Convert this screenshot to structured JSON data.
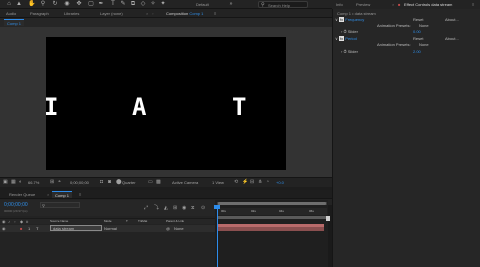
{
  "toolbar": {
    "workspace_default": "Default",
    "search_placeholder": "Search Help"
  },
  "panels": {
    "row": [
      "Audio",
      "Paragraph",
      "Libraries",
      "Layer (none)"
    ],
    "comp_tab_prefix": "Composition",
    "comp_tab_name": "Comp 1",
    "comp_subtab": "Comp 1"
  },
  "viewer": {
    "letters": [
      "I",
      "A",
      "T"
    ],
    "zoom": "66.7%",
    "timecode": "0;00;00;00",
    "resolution": "Quarter",
    "camera": "Active Camera",
    "views": "1 View",
    "exposure": "+0.0"
  },
  "right_panel": {
    "tabs": [
      "Info",
      "Preview",
      "Effect Controls data stream"
    ],
    "breadcrumb": "Comp 1 • data stream",
    "rows": [
      {
        "name": "Frequency",
        "c1": "Reset",
        "c2": "About..."
      },
      {
        "name": "Animation Presets:",
        "c1": "None"
      },
      {
        "name": "Slider",
        "value": "0.00"
      },
      {
        "name": "Period",
        "c1": "Reset",
        "c2": "About..."
      },
      {
        "name": "Animation Presets:",
        "c1": "None"
      },
      {
        "name": "Slider",
        "value": "2.00"
      }
    ]
  },
  "timeline": {
    "tabs": [
      "Render Queue",
      "Comp 1"
    ],
    "timecode": "0;00;00;00",
    "fps": "00000 (29.97 fps)",
    "columns": [
      "Source Name",
      "Mode",
      "T",
      "TrkMat",
      "Parent & Link"
    ],
    "layer": {
      "index": "1",
      "type": "T",
      "name": "data stream",
      "mode": "Normal",
      "parent": "None"
    },
    "ruler": [
      "00s",
      "02s",
      "04s",
      "06s"
    ]
  },
  "colors": {
    "accent": "#2d8ceb",
    "layer_bar": "#8a4f4f"
  }
}
